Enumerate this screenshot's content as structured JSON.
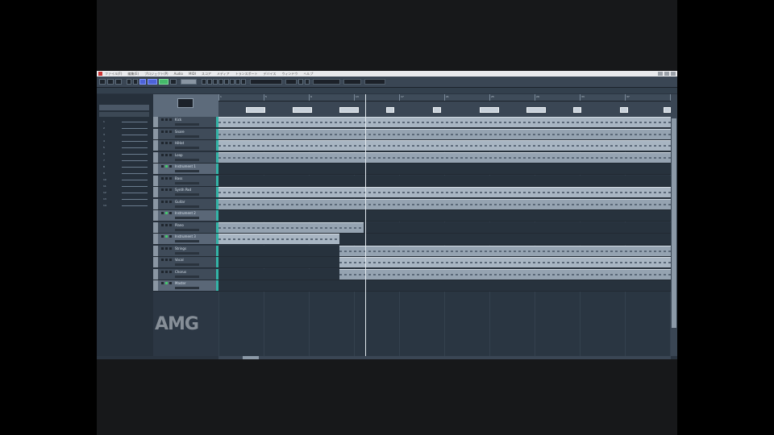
{
  "window": {
    "menus": [
      "ファイル(F)",
      "編集(E)",
      "プロジェクト(P)",
      "Audio",
      "MIDI",
      "スコア",
      "メディア",
      "トランスポート",
      "デバイス",
      "ウィンドウ",
      "ヘルプ"
    ]
  },
  "tracks": [
    {
      "name": "Kick",
      "type": "audio",
      "active": false
    },
    {
      "name": "Snare",
      "type": "audio",
      "active": false
    },
    {
      "name": "HiHat",
      "type": "audio",
      "active": false
    },
    {
      "name": "Loop",
      "type": "audio",
      "active": false
    },
    {
      "name": "Instrument 1",
      "type": "folder",
      "active": true
    },
    {
      "name": "Bass",
      "type": "audio",
      "active": false
    },
    {
      "name": "Synth Pad",
      "type": "audio",
      "active": false
    },
    {
      "name": "Guitar",
      "type": "audio",
      "active": false
    },
    {
      "name": "Instrument 2",
      "type": "folder",
      "active": true
    },
    {
      "name": "Piano",
      "type": "audio",
      "active": false
    },
    {
      "name": "Instrument 3",
      "type": "folder",
      "active": true
    },
    {
      "name": "Strings",
      "type": "audio",
      "active": false
    },
    {
      "name": "Vocal",
      "type": "audio",
      "active": false
    },
    {
      "name": "Chorus",
      "type": "audio",
      "active": false
    },
    {
      "name": "Master",
      "type": "folder",
      "active": true
    }
  ],
  "inspector_rows": [
    "1",
    "2",
    "3",
    "4",
    "5",
    "6",
    "7",
    "8",
    "9",
    "10",
    "11",
    "12",
    "13",
    "14"
  ],
  "ruler_labels": [
    "1",
    "5",
    "9",
    "13",
    "17",
    "21",
    "25",
    "29",
    "33",
    "37",
    "41"
  ],
  "watermark": "AMG",
  "colors": {
    "accent_blue": "#4d63d8",
    "active_green": "#45b96a",
    "level_teal": "#33b3a6",
    "clip": "#a8b5c2"
  }
}
